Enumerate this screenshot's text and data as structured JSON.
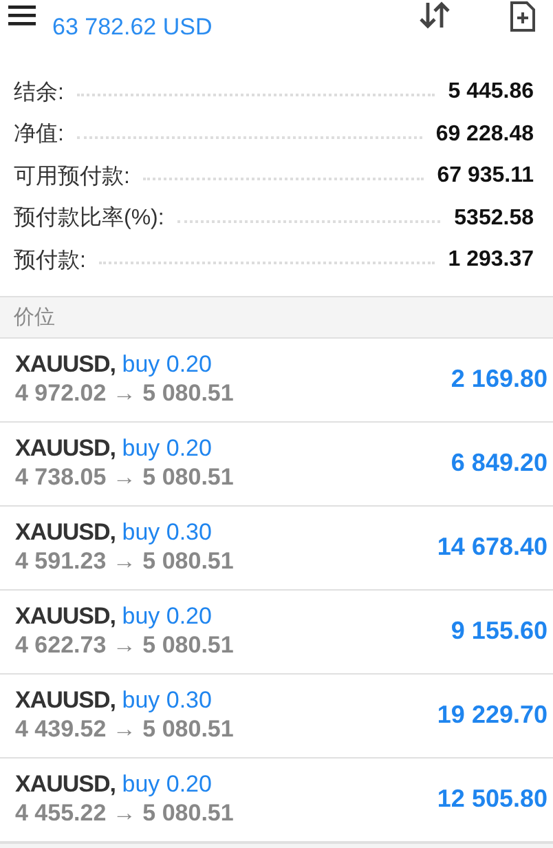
{
  "header": {
    "balance": "63 782.62 USD"
  },
  "summary": [
    {
      "label": "结余:",
      "value": "5 445.86"
    },
    {
      "label": "净值:",
      "value": "69 228.48"
    },
    {
      "label": "可用预付款:",
      "value": "67 935.11"
    },
    {
      "label": "预付款比率(%):",
      "value": "5352.58"
    },
    {
      "label": "预付款:",
      "value": "1 293.37"
    }
  ],
  "positions_header": "价位",
  "positions": [
    {
      "symbol": "XAUUSD,",
      "trade": "buy 0.20",
      "open_price": "4 972.02",
      "arrow": "→",
      "current_price": "5 080.51",
      "profit": "2 169.80"
    },
    {
      "symbol": "XAUUSD,",
      "trade": "buy 0.20",
      "open_price": "4 738.05",
      "arrow": "→",
      "current_price": "5 080.51",
      "profit": "6 849.20"
    },
    {
      "symbol": "XAUUSD,",
      "trade": "buy 0.30",
      "open_price": "4 591.23",
      "arrow": "→",
      "current_price": "5 080.51",
      "profit": "14 678.40"
    },
    {
      "symbol": "XAUUSD,",
      "trade": "buy 0.20",
      "open_price": "4 622.73",
      "arrow": "→",
      "current_price": "5 080.51",
      "profit": "9 155.60"
    },
    {
      "symbol": "XAUUSD,",
      "trade": "buy 0.30",
      "open_price": "4 439.52",
      "arrow": "→",
      "current_price": "5 080.51",
      "profit": "19 229.70"
    },
    {
      "symbol": "XAUUSD,",
      "trade": "buy 0.20",
      "open_price": "4 455.22",
      "arrow": "→",
      "current_price": "5 080.51",
      "profit": "12 505.80"
    }
  ]
}
